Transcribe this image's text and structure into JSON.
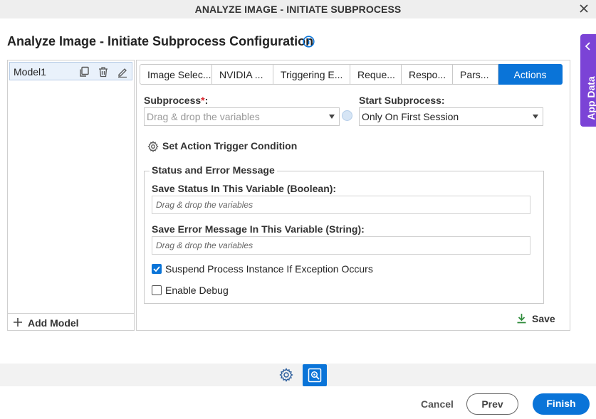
{
  "window": {
    "title": "ANALYZE IMAGE - INITIATE SUBPROCESS"
  },
  "page": {
    "title": "Analyze Image - Initiate Subprocess Configuration"
  },
  "app_data": {
    "label": "App Data"
  },
  "models": {
    "items": [
      {
        "label": "Model1"
      }
    ],
    "add_label": "Add Model"
  },
  "tabs": [
    {
      "label": "Image Selec..."
    },
    {
      "label": "NVIDIA ..."
    },
    {
      "label": "Triggering E..."
    },
    {
      "label": "Reque..."
    },
    {
      "label": "Respo..."
    },
    {
      "label": "Pars..."
    },
    {
      "label": "Actions",
      "active": true
    }
  ],
  "form": {
    "subprocess": {
      "label": "Subprocess",
      "required_mark": "*",
      "colon": ":",
      "placeholder": "Drag & drop the variables"
    },
    "start_subprocess": {
      "label": "Start Subprocess:",
      "value": "Only On First Session"
    },
    "trigger_condition": {
      "label": "Set Action Trigger Condition"
    },
    "status_section": {
      "legend": "Status and Error Message",
      "save_status": {
        "label": "Save Status In This Variable (Boolean):",
        "placeholder": "Drag & drop the variables"
      },
      "save_error": {
        "label": "Save Error Message In This Variable (String):",
        "placeholder": "Drag & drop the variables"
      },
      "suspend": {
        "label": "Suspend Process Instance If Exception Occurs",
        "checked": true
      },
      "debug": {
        "label": "Enable Debug",
        "checked": false
      }
    },
    "save_label": "Save"
  },
  "footer": {
    "cancel_label": "Cancel",
    "prev_label": "Prev",
    "finish_label": "Finish"
  },
  "colors": {
    "primary": "#0a74d8",
    "app_data": "#7b43d6",
    "save_icon": "#2e8b3a"
  }
}
